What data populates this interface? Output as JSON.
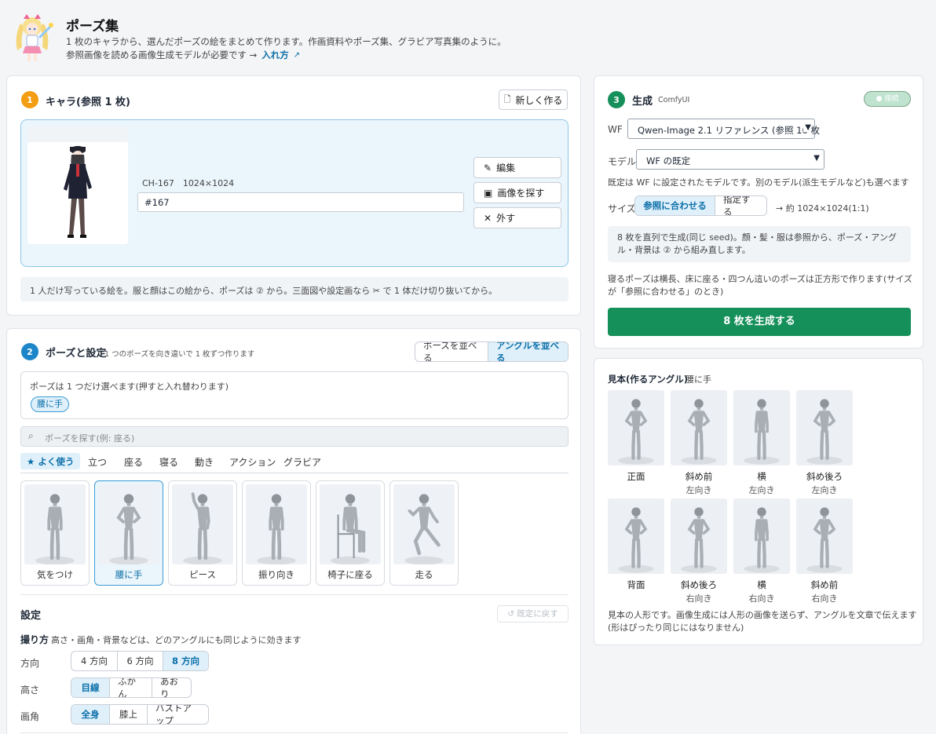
{
  "header": {
    "title": "ポーズ集",
    "desc1": "1 枚のキャラから、選んだポーズの絵をまとめて作ります。作画資料やポーズ集、グラビア写真集のように。",
    "desc2": "参照画像を読める画像生成モデルが必要です →",
    "link": "入れ方"
  },
  "chara": {
    "num": "1",
    "title": "キャラ(参照 1 枚)",
    "new_btn": "新しく作る",
    "meta": "CH-167　1024×1024",
    "name": "#167",
    "edit": "編集",
    "find": "画像を探す",
    "remove": "外す",
    "note": "1 人だけ写っている絵を。服と顔はこの絵から、ポーズは ② から。三面図や設定画なら ✂ で 1 体だけ切り抜いてから。"
  },
  "pose": {
    "num": "2",
    "title": "ポーズと設定",
    "subtitle": "1 つのポーズを向き違いで 1 枚ずつ作ります",
    "seg": [
      "ポーズを並べる",
      "アングルを並べる"
    ],
    "hint": "ポーズは 1 つだけ選べます(押すと入れ替わります)",
    "chip": "腰に手",
    "search_placeholder": "ポーズを探す(例: 座る)",
    "tabs": [
      "★ よく使う",
      "立つ",
      "座る",
      "寝る",
      "動き",
      "アクション",
      "グラビア"
    ],
    "thumbs": [
      "気をつけ",
      "腰に手",
      "ピース",
      "振り向き",
      "椅子に座る",
      "走る"
    ]
  },
  "settings": {
    "title": "設定",
    "reset": "↺ 既定に戻す",
    "shoot_label": "撮り方",
    "shoot_desc": "高さ・画角・背景などは、どのアングルにも同じように効きます",
    "dir_label": "方向",
    "dir": [
      "4 方向",
      "6 方向",
      "8 方向"
    ],
    "height_label": "高さ",
    "height": [
      "目線",
      "ふかん",
      "あおり"
    ],
    "frame_label": "画角",
    "frame": [
      "全身",
      "膝上",
      "バストアップ"
    ]
  },
  "gen": {
    "num": "3",
    "title": "生成",
    "sub": "ComfyUI",
    "status": "● 接続",
    "wf_label": "WF",
    "wf_value": "Qwen-Image 2.1 リファレンス (参照 10 枚",
    "model_label": "モデル",
    "model_value": "WF の既定",
    "model_note": "既定は WF に設定されたモデルです。別のモデル(派生モデルなど)も選べます",
    "size_label": "サイズ",
    "size": [
      "参照に合わせる",
      "指定する"
    ],
    "size_info": "→ 約 1024×1024(1:1)",
    "info": "8 枚を直列で生成(同じ seed)。顔・髪・服は参照から、ポーズ・アングル・背景は ② から組み直します。",
    "note": "寝るポーズは横長、床に座る・四つん這いのポーズは正方形で作ります(サイズが「参照に合わせる」のとき)",
    "button": "8 枚を生成する"
  },
  "sample": {
    "title": "見本(作るアングル)",
    "pose": "腰に手",
    "angles": [
      {
        "l1": "正面",
        "l2": ""
      },
      {
        "l1": "斜め前",
        "l2": "左向き"
      },
      {
        "l1": "横",
        "l2": "左向き"
      },
      {
        "l1": "斜め後ろ",
        "l2": "左向き"
      },
      {
        "l1": "背面",
        "l2": ""
      },
      {
        "l1": "斜め後ろ",
        "l2": "右向き"
      },
      {
        "l1": "横",
        "l2": "右向き"
      },
      {
        "l1": "斜め前",
        "l2": "右向き"
      }
    ],
    "note1": "見本の人形です。画像生成には人形の画像を送らず、アングルを文章で伝えます",
    "note2": "(形はぴったり同じにはなりません)"
  },
  "colors": {
    "orange": "#f29d12",
    "blue": "#1d86c8",
    "green": "#16905a"
  }
}
